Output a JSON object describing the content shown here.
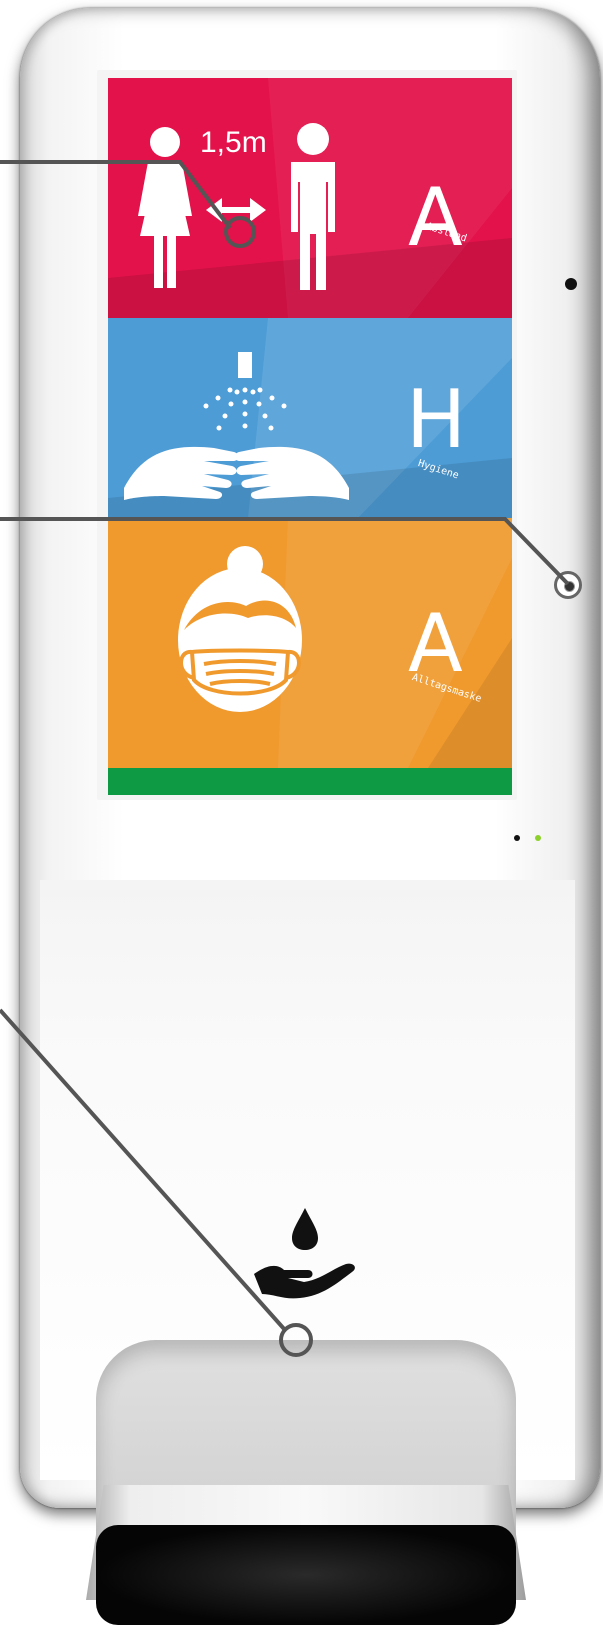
{
  "panels": [
    {
      "letter": "A",
      "word": "Abstand",
      "color": "#e3124a"
    },
    {
      "letter": "H",
      "word": "Hygiene",
      "color": "#4d9cd6"
    },
    {
      "letter": "A",
      "word": "Alltagsmaske",
      "color": "#f09a2e"
    }
  ],
  "distance_label": "1,5m",
  "accent_green": "#0e9a45",
  "icons": [
    "woman-icon",
    "man-icon",
    "distance-arrows-icon",
    "sprayer-icon",
    "hands-icon",
    "masked-face-icon",
    "drop-hand-icon"
  ]
}
